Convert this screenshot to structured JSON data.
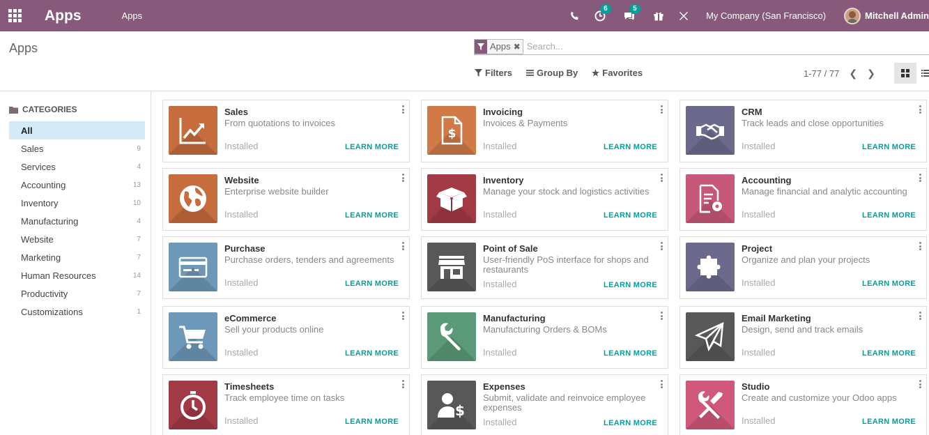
{
  "navbar": {
    "brand": "Apps",
    "menu": "Apps",
    "activity_badge": "6",
    "messages_badge": "5",
    "company": "My Company (San Francisco)",
    "user": "Mitchell Admin"
  },
  "control": {
    "title": "Apps",
    "facet_label": "Apps",
    "facet_remove": "✖",
    "search_placeholder": "Search...",
    "filters_label": "Filters",
    "groupby_label": "Group By",
    "favorites_label": "Favorites",
    "pager": "1-77 / 77"
  },
  "sidebar": {
    "heading": "CATEGORIES",
    "items": [
      {
        "label": "All",
        "count": ""
      },
      {
        "label": "Sales",
        "count": "9"
      },
      {
        "label": "Services",
        "count": "4"
      },
      {
        "label": "Accounting",
        "count": "13"
      },
      {
        "label": "Inventory",
        "count": "10"
      },
      {
        "label": "Manufacturing",
        "count": "4"
      },
      {
        "label": "Website",
        "count": "7"
      },
      {
        "label": "Marketing",
        "count": "7"
      },
      {
        "label": "Human Resources",
        "count": "14"
      },
      {
        "label": "Productivity",
        "count": "7"
      },
      {
        "label": "Customizations",
        "count": "1"
      }
    ]
  },
  "apps": [
    {
      "name": "Sales",
      "desc": "From quotations to invoices",
      "status": "Installed",
      "learn": "LEARN MORE",
      "color": "#c66c3d",
      "icon": "sales-chart-icon"
    },
    {
      "name": "Invoicing",
      "desc": "Invoices & Payments",
      "status": "Installed",
      "learn": "LEARN MORE",
      "color": "#d07a47",
      "icon": "invoice-document-icon"
    },
    {
      "name": "CRM",
      "desc": "Track leads and close opportunities",
      "status": "Installed",
      "learn": "LEARN MORE",
      "color": "#6b6a8c",
      "icon": "handshake-icon"
    },
    {
      "name": "Website",
      "desc": "Enterprise website builder",
      "status": "Installed",
      "learn": "LEARN MORE",
      "color": "#c66c3d",
      "icon": "globe-icon"
    },
    {
      "name": "Inventory",
      "desc": "Manage your stock and logistics activities",
      "status": "Installed",
      "learn": "LEARN MORE",
      "color": "#a23a46",
      "icon": "box-icon"
    },
    {
      "name": "Accounting",
      "desc": "Manage financial and analytic accounting",
      "status": "Installed",
      "learn": "LEARN MORE",
      "color": "#c8587a",
      "icon": "document-gear-icon"
    },
    {
      "name": "Purchase",
      "desc": "Purchase orders, tenders and agreements",
      "status": "Installed",
      "learn": "LEARN MORE",
      "color": "#6e98b8",
      "icon": "credit-card-icon"
    },
    {
      "name": "Point of Sale",
      "desc": "User-friendly PoS interface for shops and restaurants",
      "status": "Installed",
      "learn": "LEARN MORE",
      "color": "#585858",
      "icon": "shop-icon"
    },
    {
      "name": "Project",
      "desc": "Organize and plan your projects",
      "status": "Installed",
      "learn": "LEARN MORE",
      "color": "#6b6a8c",
      "icon": "puzzle-icon"
    },
    {
      "name": "eCommerce",
      "desc": "Sell your products online",
      "status": "Installed",
      "learn": "LEARN MORE",
      "color": "#6e98b8",
      "icon": "cart-icon"
    },
    {
      "name": "Manufacturing",
      "desc": "Manufacturing Orders & BOMs",
      "status": "Installed",
      "learn": "LEARN MORE",
      "color": "#5a9a78",
      "icon": "wrench-icon"
    },
    {
      "name": "Email Marketing",
      "desc": "Design, send and track emails",
      "status": "Installed",
      "learn": "LEARN MORE",
      "color": "#585858",
      "icon": "paper-plane-icon"
    },
    {
      "name": "Timesheets",
      "desc": "Track employee time on tasks",
      "status": "Installed",
      "learn": "LEARN MORE",
      "color": "#a23a46",
      "icon": "stopwatch-icon"
    },
    {
      "name": "Expenses",
      "desc": "Submit, validate and reinvoice employee expenses",
      "status": "Installed",
      "learn": "LEARN MORE",
      "color": "#585858",
      "icon": "user-dollar-icon"
    },
    {
      "name": "Studio",
      "desc": "Create and customize your Odoo apps",
      "status": "Installed",
      "learn": "LEARN MORE",
      "color": "#d0587a",
      "icon": "tools-icon"
    }
  ]
}
